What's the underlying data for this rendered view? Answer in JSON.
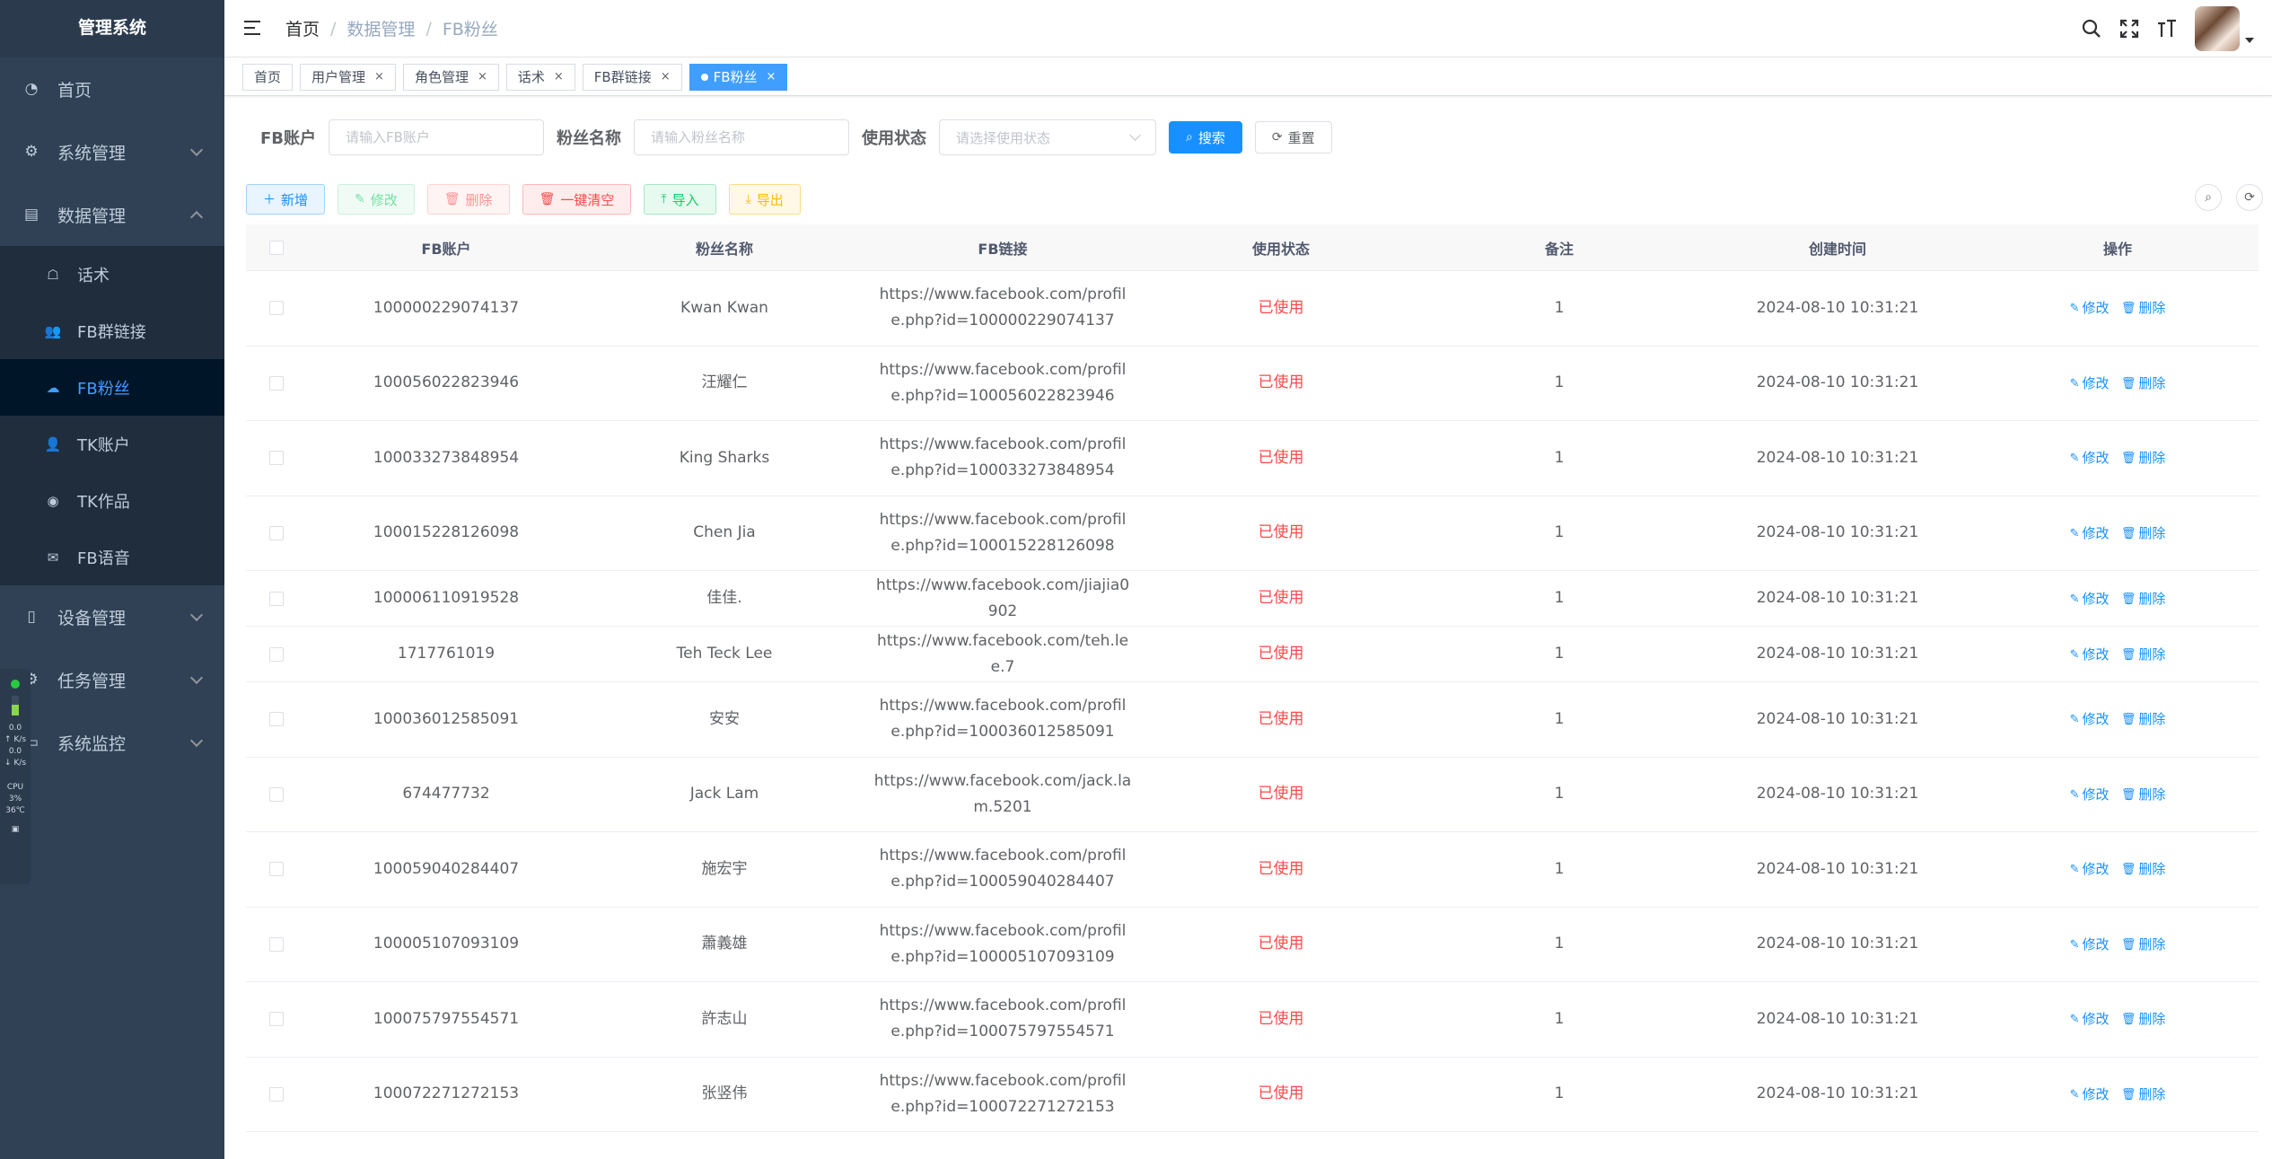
{
  "app": {
    "title": "管理系统"
  },
  "sidebar": {
    "items": [
      {
        "label": "首页",
        "icon": "dashboard-icon"
      },
      {
        "label": "系统管理",
        "icon": "gear-icon"
      },
      {
        "label": "数据管理",
        "icon": "calendar-icon"
      }
    ],
    "sub_items": [
      {
        "label": "话术",
        "icon": "chat-icon"
      },
      {
        "label": "FB群链接",
        "icon": "group-icon"
      },
      {
        "label": "FB粉丝",
        "icon": "cloud-upload-icon"
      },
      {
        "label": "TK账户",
        "icon": "user-icon"
      },
      {
        "label": "TK作品",
        "icon": "eye-icon"
      },
      {
        "label": "FB语音",
        "icon": "wechat-icon"
      }
    ],
    "items_after": [
      {
        "label": "设备管理",
        "icon": "phone-icon"
      },
      {
        "label": "任务管理",
        "icon": "gear-icon"
      },
      {
        "label": "系统监控",
        "icon": "monitor-icon"
      }
    ]
  },
  "monitor": {
    "up": "0.0",
    "up_unit": "↑ K/s",
    "down": "0.0",
    "down_unit": "↓ K/s",
    "cpu_label": "CPU",
    "cpu": "3%",
    "temp": "36℃"
  },
  "breadcrumb": [
    "首页",
    "数据管理",
    "FB粉丝"
  ],
  "tags": [
    "首页",
    "用户管理",
    "角色管理",
    "话术",
    "FB群链接",
    "FB粉丝"
  ],
  "search": {
    "fb_account_label": "FB账户",
    "fb_account_placeholder": "请输入FB账户",
    "fan_name_label": "粉丝名称",
    "fan_name_placeholder": "请输入粉丝名称",
    "status_label": "使用状态",
    "status_placeholder": "请选择使用状态",
    "search_btn": "搜索",
    "reset_btn": "重置"
  },
  "toolbar": {
    "add": "新增",
    "edit": "修改",
    "delete": "删除",
    "clear": "一键清空",
    "import": "导入",
    "export": "导出"
  },
  "table": {
    "columns": [
      "FB账户",
      "粉丝名称",
      "FB链接",
      "使用状态",
      "备注",
      "创建时间",
      "操作"
    ],
    "edit_label": "修改",
    "delete_label": "删除",
    "rows": [
      {
        "account": "100000229074137",
        "name": "Kwan Kwan",
        "link": "https://www.facebook.com/profile.php?id=100000229074137",
        "status": "已使用",
        "remark": "1",
        "created": "2024-08-10 10:31:21"
      },
      {
        "account": "100056022823946",
        "name": "汪耀仁",
        "link": "https://www.facebook.com/profile.php?id=100056022823946",
        "status": "已使用",
        "remark": "1",
        "created": "2024-08-10 10:31:21"
      },
      {
        "account": "100033273848954",
        "name": "King Sharks",
        "link": "https://www.facebook.com/profile.php?id=100033273848954",
        "status": "已使用",
        "remark": "1",
        "created": "2024-08-10 10:31:21"
      },
      {
        "account": "100015228126098",
        "name": "Chen Jia",
        "link": "https://www.facebook.com/profile.php?id=100015228126098",
        "status": "已使用",
        "remark": "1",
        "created": "2024-08-10 10:31:21"
      },
      {
        "account": "100006110919528",
        "name": "佳佳.",
        "link": "https://www.facebook.com/jiajia0902",
        "status": "已使用",
        "remark": "1",
        "created": "2024-08-10 10:31:21"
      },
      {
        "account": "1717761019",
        "name": "Teh Teck Lee",
        "link": "https://www.facebook.com/teh.lee.7",
        "status": "已使用",
        "remark": "1",
        "created": "2024-08-10 10:31:21"
      },
      {
        "account": "100036012585091",
        "name": "安安",
        "link": "https://www.facebook.com/profile.php?id=100036012585091",
        "status": "已使用",
        "remark": "1",
        "created": "2024-08-10 10:31:21"
      },
      {
        "account": "674477732",
        "name": "Jack Lam",
        "link": "https://www.facebook.com/jack.lam.5201",
        "status": "已使用",
        "remark": "1",
        "created": "2024-08-10 10:31:21"
      },
      {
        "account": "100059040284407",
        "name": "施宏宇",
        "link": "https://www.facebook.com/profile.php?id=100059040284407",
        "status": "已使用",
        "remark": "1",
        "created": "2024-08-10 10:31:21"
      },
      {
        "account": "100005107093109",
        "name": "蕭義雄",
        "link": "https://www.facebook.com/profile.php?id=100005107093109",
        "status": "已使用",
        "remark": "1",
        "created": "2024-08-10 10:31:21"
      },
      {
        "account": "100075797554571",
        "name": "許志山",
        "link": "https://www.facebook.com/profile.php?id=100075797554571",
        "status": "已使用",
        "remark": "1",
        "created": "2024-08-10 10:31:21"
      },
      {
        "account": "100072271272153",
        "name": "张竖伟",
        "link": "https://www.facebook.com/profile.php?id=100072271272153",
        "status": "已使用",
        "remark": "1",
        "created": "2024-08-10 10:31:21"
      }
    ]
  },
  "colors": {
    "sidebar_bg": "#304156",
    "primary": "#1890ff",
    "danger": "#ff4949",
    "active_text": "#409eff"
  }
}
